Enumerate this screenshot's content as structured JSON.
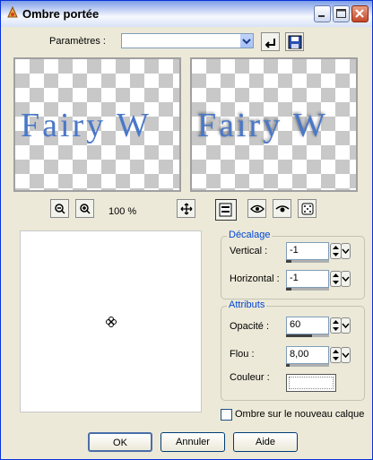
{
  "window": {
    "title": "Ombre portée"
  },
  "settings": {
    "label": "Paramètres :",
    "value": ""
  },
  "preview": {
    "sample_text": "Fairy  W",
    "zoom": "100 %"
  },
  "offset": {
    "group_title": "Décalage",
    "vertical_label": "Vertical :",
    "vertical_value": "-1",
    "horizontal_label": "Horizontal :",
    "horizontal_value": "-1"
  },
  "attributes": {
    "group_title": "Attributs",
    "opacity_label": "Opacité :",
    "opacity_value": "60",
    "blur_label": "Flou :",
    "blur_value": "8,00",
    "color_label": "Couleur :",
    "color_value": "#ffffff"
  },
  "new_layer": {
    "label": "Ombre sur le nouveau calque",
    "checked": false
  },
  "buttons": {
    "ok": "OK",
    "cancel": "Annuler",
    "help": "Aide"
  },
  "colors": {
    "accent": "#0046d5",
    "title_border": "#0831d9"
  }
}
